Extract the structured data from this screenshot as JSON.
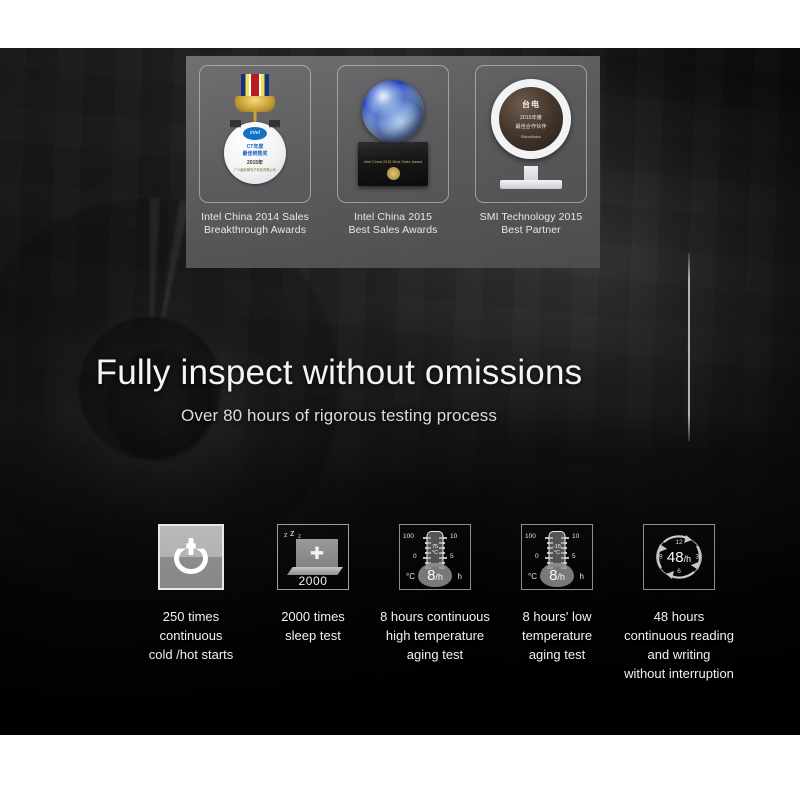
{
  "awards": {
    "items": [
      {
        "icon": "medal-trophy-icon",
        "caption_line1": "Intel China 2014 Sales",
        "caption_line2": "Breakthrough Awards",
        "medal": {
          "badge": "intel",
          "line1": "CT年度",
          "line2": "最佳销售奖",
          "line3": "2015年",
          "line4": "广州晶科微电子科技有限公司"
        }
      },
      {
        "icon": "crystal-ball-trophy-icon",
        "caption_line1": "Intel China 2015",
        "caption_line2": "Best Sales Awards",
        "base_text": "Intel China 2015 Best Sales Award"
      },
      {
        "icon": "smi-plaque-trophy-icon",
        "caption_line1": "SMI Technology 2015",
        "caption_line2": "Best Partner",
        "plaque": {
          "brand": "台电",
          "line1": "2015年度",
          "line2": "最佳合作伙伴",
          "line3": "SiliconMotion"
        }
      }
    ]
  },
  "hero": {
    "headline": "Fully inspect without omissions",
    "subheadline": "Over 80 hours of rigorous testing process"
  },
  "features": [
    {
      "icon": "power-button-icon",
      "label_lines": [
        "250 times",
        "continuous",
        "cold /hot starts"
      ]
    },
    {
      "icon": "laptop-sleep-icon",
      "laptop_count": "2000",
      "sleep_marks": [
        "z",
        "z",
        "z"
      ],
      "label_lines": [
        "2000 times",
        "sleep test"
      ]
    },
    {
      "icon": "thermometer-high-icon",
      "scale_left": [
        "100",
        "0"
      ],
      "scale_right": [
        "10",
        "5"
      ],
      "unit_left": "°C",
      "unit_right": "h",
      "tube_value": "75",
      "tube_unit": "°C",
      "bulb_value": "8",
      "bulb_suffix": "/h",
      "label_lines": [
        "8 hours continuous",
        "high temperature",
        "aging test"
      ]
    },
    {
      "icon": "thermometer-low-icon",
      "scale_left": [
        "100",
        "0"
      ],
      "scale_right": [
        "10",
        "5"
      ],
      "unit_left": "°C",
      "unit_right": "h",
      "tube_value": "-15",
      "tube_unit": "°C",
      "bulb_value": "8",
      "bulb_suffix": "/h",
      "label_lines": [
        "8 hours' low",
        "temperature",
        "aging test"
      ]
    },
    {
      "icon": "clock-cycle-icon",
      "dial_numbers": {
        "top": "12",
        "right": "3",
        "bottom": "6",
        "left": "9"
      },
      "dial_value": "48",
      "dial_suffix": "/h",
      "label_lines": [
        "48 hours",
        "continuous reading",
        "and writing",
        "without interruption"
      ]
    }
  ],
  "colors": {
    "stage_background": "#000000",
    "page_background": "#ffffff",
    "awards_panel": "#6e6e70",
    "text_primary": "#f4f4f6",
    "text_secondary": "#dcdcde",
    "divider": "#cdcdd0"
  }
}
